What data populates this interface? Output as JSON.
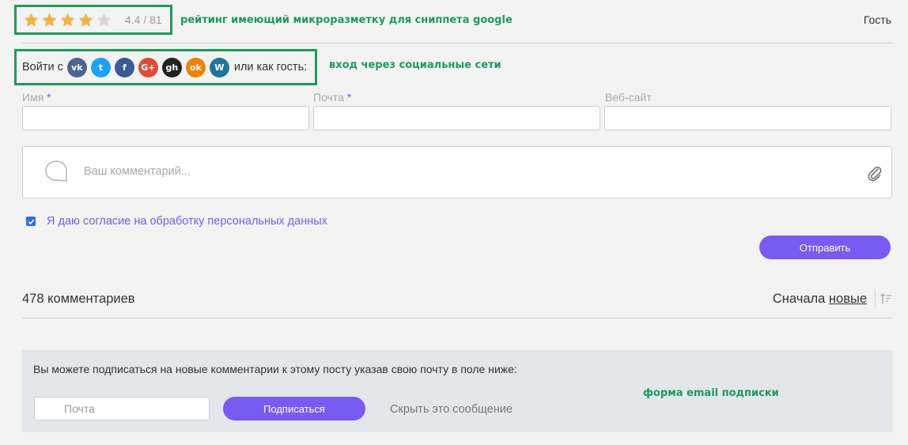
{
  "rating": {
    "value": 4.4,
    "max_stars": 5,
    "text": "4.4 / 81",
    "note": "рейтинг имеющий микроразметку для сниппета google",
    "star_color": "#f2b24a",
    "star_empty_color": "#d5d5d5"
  },
  "user": {
    "guest_label": "Гость"
  },
  "login": {
    "prefix": "Войти с",
    "suffix": "или как гость:",
    "note": "вход через социальные сети",
    "providers": [
      {
        "name": "vk",
        "glyph": "vk",
        "color": "#4a6590"
      },
      {
        "name": "twitter",
        "glyph": "t",
        "color": "#1da1f2"
      },
      {
        "name": "facebook",
        "glyph": "f",
        "color": "#3b5998"
      },
      {
        "name": "google",
        "glyph": "G+",
        "color": "#dd4b39"
      },
      {
        "name": "github",
        "glyph": "gh",
        "color": "#222222"
      },
      {
        "name": "odnoklassniki",
        "glyph": "ok",
        "color": "#ee8208"
      },
      {
        "name": "wordpress",
        "glyph": "W",
        "color": "#21759b"
      }
    ]
  },
  "form": {
    "name_label": "Имя",
    "email_label": "Почта",
    "website_label": "Веб-сайт",
    "required_mark": "*",
    "comment_placeholder": "Ваш комментарий...",
    "consent_label": "Я даю согласие на обработку персональных данных",
    "consent_checked": true,
    "submit_label": "Отправить"
  },
  "comments": {
    "count_label": "478 комментариев",
    "sort_prefix": "Сначала",
    "sort_value": "новые"
  },
  "subscribe": {
    "text": "Вы можете подписаться на новые комментарии к этому посту указав свою почту в поле ниже:",
    "email_placeholder": "Почта",
    "button_label": "Подписаться",
    "hide_label": "Скрыть это сообщение",
    "note": "форма email подписки"
  },
  "colors": {
    "accent": "#7a5af0",
    "annotation": "#1f9a5a",
    "background": "#f3f3f3"
  }
}
